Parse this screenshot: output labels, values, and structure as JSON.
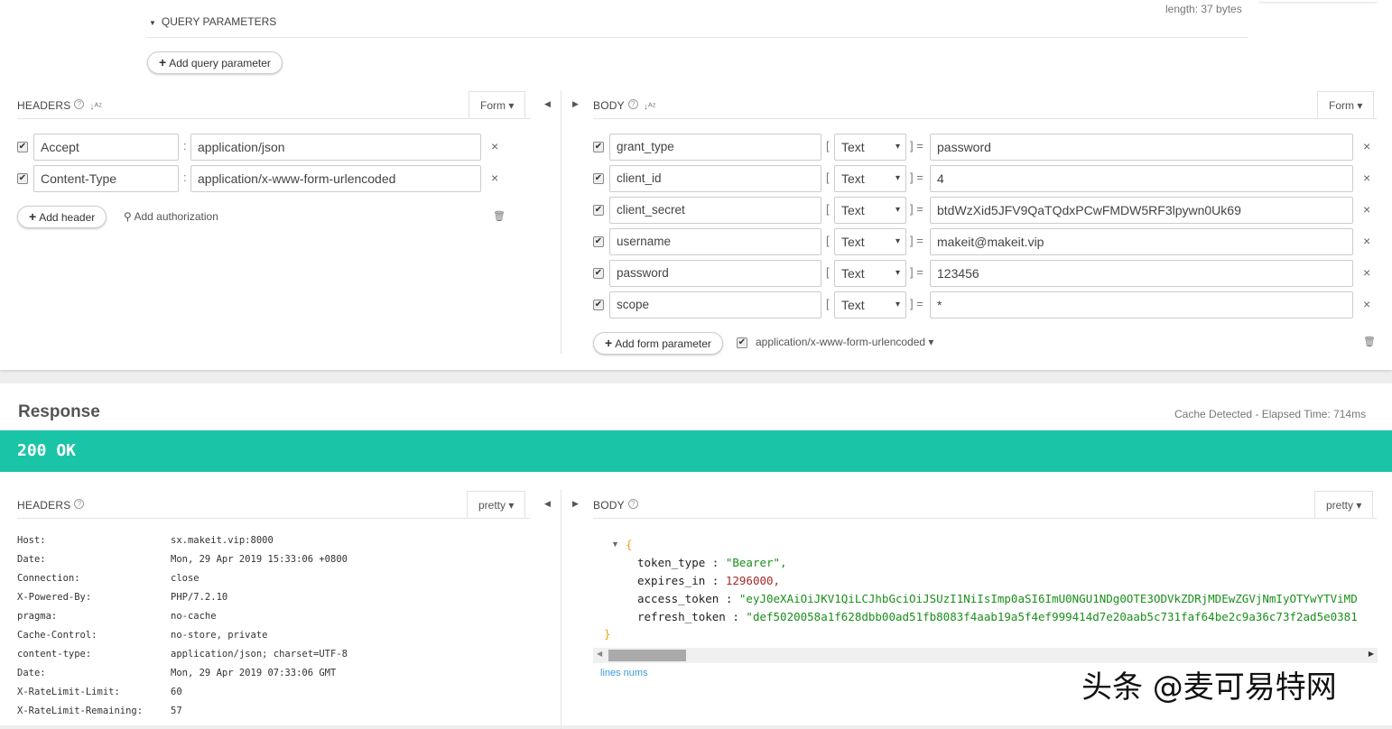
{
  "request": {
    "length_text": "length: 37 bytes",
    "query": {
      "title": "QUERY PARAMETERS",
      "add_label": "Add query parameter"
    },
    "headers": {
      "title": "HEADERS",
      "mode": "Form",
      "add_label": "Add header",
      "auth_label": "Add authorization",
      "rows": [
        {
          "key": "Accept",
          "value": "application/json",
          "checked": true
        },
        {
          "key": "Content-Type",
          "value": "application/x-www-form-urlencoded",
          "checked": true
        }
      ]
    },
    "body": {
      "title": "BODY",
      "mode": "Form",
      "add_label": "Add form parameter",
      "content_type": "application/x-www-form-urlencoded",
      "rows": [
        {
          "key": "grant_type",
          "type": "Text",
          "value": "password",
          "checked": true
        },
        {
          "key": "client_id",
          "type": "Text",
          "value": "4",
          "checked": true
        },
        {
          "key": "client_secret",
          "type": "Text",
          "value": "btdWzXid5JFV9QaTQdxPCwFMDW5RF3lpywn0Uk69",
          "checked": true
        },
        {
          "key": "username",
          "type": "Text",
          "value": "makeit@makeit.vip",
          "checked": true
        },
        {
          "key": "password",
          "type": "Text",
          "value": "123456",
          "checked": true
        },
        {
          "key": "scope",
          "type": "Text",
          "value": "*",
          "checked": true
        }
      ]
    }
  },
  "response": {
    "title": "Response",
    "meta": "Cache Detected - Elapsed Time: 714ms",
    "status": "200 OK",
    "status_color": "#1ac4a6",
    "headers": {
      "title": "HEADERS",
      "mode": "pretty",
      "rows": [
        {
          "k": "Host:",
          "v": "sx.makeit.vip:8000"
        },
        {
          "k": "Date:",
          "v": "Mon, 29 Apr 2019 15:33:06 +0800"
        },
        {
          "k": "Connection:",
          "v": "close"
        },
        {
          "k": "X-Powered-By:",
          "v": "PHP/7.2.10"
        },
        {
          "k": "pragma:",
          "v": "no-cache"
        },
        {
          "k": "Cache-Control:",
          "v": "no-store, private"
        },
        {
          "k": "content-type:",
          "v": "application/json; charset=UTF-8"
        },
        {
          "k": "Date:",
          "v": "Mon, 29 Apr 2019 07:33:06 GMT"
        },
        {
          "k": "X-RateLimit-Limit:",
          "v": "60"
        },
        {
          "k": "X-RateLimit-Remaining:",
          "v": "57"
        }
      ]
    },
    "body": {
      "title": "BODY",
      "mode": "pretty",
      "open_brace": "{",
      "close_brace": "}",
      "fields": [
        {
          "k": "token_type",
          "v": "\"Bearer\",",
          "kind": "str"
        },
        {
          "k": "expires_in",
          "v": "1296000,",
          "kind": "num"
        },
        {
          "k": "access_token",
          "v": "\"eyJ0eXAiOiJKV1QiLCJhbGciOiJSUzI1NiIsImp0aSI6ImU0NGU1NDg0OTE3ODVkZDRjMDEwZGVjNmIyOTYwYTViMD",
          "kind": "str"
        },
        {
          "k": "refresh_token",
          "v": "\"def5020058a1f628dbb00ad51fb8083f4aab19a5f4ef999414d7e20aab5c731faf64be2c9a36c73f2ad5e0381",
          "kind": "str"
        }
      ],
      "lines_label": "lines nums"
    }
  },
  "watermark": "头条 @麦可易特网"
}
